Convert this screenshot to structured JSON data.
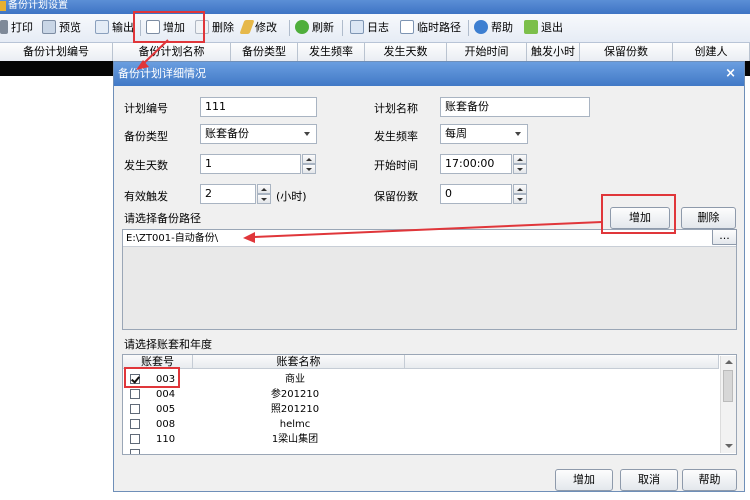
{
  "window": {
    "title": "备份计划设置"
  },
  "toolbar": {
    "print": "打印",
    "preview": "预览",
    "export": "输出",
    "add": "增加",
    "delete": "删除",
    "edit": "修改",
    "refresh": "刷新",
    "log": "日志",
    "temp_path": "临时路径",
    "help": "帮助",
    "exit": "退出"
  },
  "grid": {
    "columns": [
      "备份计划编号",
      "备份计划名称",
      "备份类型",
      "发生频率",
      "发生天数",
      "开始时间",
      "触发小时",
      "保留份数",
      "创建人"
    ]
  },
  "dialog": {
    "title": "备份计划详细情况",
    "close": "×",
    "plan_no_label": "计划编号",
    "plan_no": "111",
    "plan_name_label": "计划名称",
    "plan_name": "账套备份",
    "backup_type_label": "备份类型",
    "backup_type": "账套备份",
    "frequency_label": "发生频率",
    "frequency": "每周",
    "days_label": "发生天数",
    "days": "1",
    "start_time_label": "开始时间",
    "start_time": "17:00:00",
    "trigger_label": "有效触发",
    "trigger": "2",
    "trigger_unit": "(小时)",
    "keep_label": "保留份数",
    "keep": "0",
    "path_section": "请选择备份路径",
    "path_add": "增加",
    "path_delete": "删除",
    "path_value": "E:\\ZT001-自动备份\\",
    "path_browse": "...",
    "account_section": "请选择账套和年度",
    "account_headers": [
      "账套号",
      "账套名称"
    ],
    "accounts": [
      {
        "code": "003",
        "name": "商业",
        "checked": true
      },
      {
        "code": "004",
        "name": "参201210",
        "checked": false
      },
      {
        "code": "005",
        "name": "照201210",
        "checked": false
      },
      {
        "code": "008",
        "name": "helmc",
        "checked": false
      },
      {
        "code": "110",
        "name": "1梁山集团",
        "checked": false
      }
    ],
    "ok": "增加",
    "cancel": "取消",
    "help": "帮助"
  },
  "colors": {
    "highlight": "#e0363a",
    "title_bar": "#4179c6"
  }
}
